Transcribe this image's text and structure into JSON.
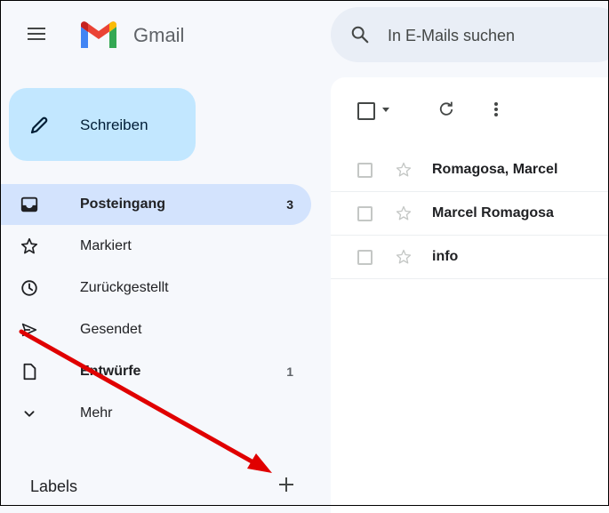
{
  "header": {
    "brand": "Gmail",
    "search_placeholder": "In E-Mails suchen",
    "icons": {
      "menu": "hamburger-icon",
      "logo": "gmail-logo",
      "search": "search-icon"
    }
  },
  "compose": {
    "label": "Schreiben",
    "icon": "pencil-icon"
  },
  "nav": {
    "items": [
      {
        "label": "Posteingang",
        "count": "3",
        "icon": "inbox-icon",
        "active": true,
        "bold": true
      },
      {
        "label": "Markiert",
        "count": "",
        "icon": "star-icon"
      },
      {
        "label": "Zurückgestellt",
        "count": "",
        "icon": "clock-icon"
      },
      {
        "label": "Gesendet",
        "count": "",
        "icon": "send-icon"
      },
      {
        "label": "Entwürfe",
        "count": "1",
        "icon": "draft-icon",
        "bold": true
      },
      {
        "label": "Mehr",
        "count": "",
        "icon": "chevron-down-icon"
      }
    ]
  },
  "labels": {
    "title": "Labels",
    "add_icon": "plus-icon"
  },
  "toolbar": {
    "icons": [
      "select-checkbox",
      "caret-down-icon",
      "refresh-icon",
      "more-vert-icon"
    ]
  },
  "emails": [
    {
      "sender": "Romagosa, Marcel"
    },
    {
      "sender": "Marcel Romagosa"
    },
    {
      "sender": "info"
    }
  ],
  "colors": {
    "background": "#f6f8fc",
    "compose": "#c2e7ff",
    "active_nav": "#d3e3fd",
    "search": "#e9eef6",
    "arrow": "#e00000"
  }
}
